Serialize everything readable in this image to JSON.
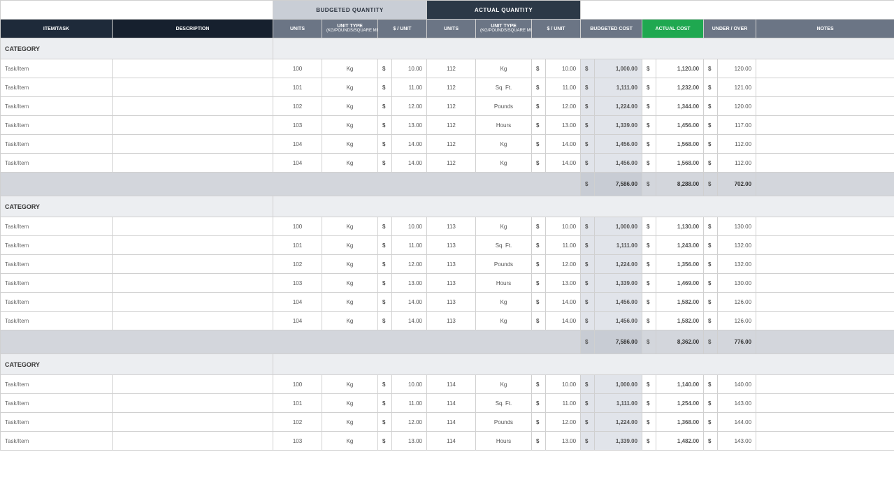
{
  "headers": {
    "group_budget": "BUDGETED QUANTITY",
    "group_actual": "ACTUAL QUANTITY",
    "item_task": "ITEM/TASK",
    "description": "DESCRIPTION",
    "units": "UNITS",
    "unit_type": "UNIT TYPE",
    "unit_type_sub": "(KG/POUNDS/SQUARE METERS)",
    "per_unit": "$ / UNIT",
    "budgeted_cost": "BUDGETED COST",
    "actual_cost": "ACTUAL COST",
    "under_over": "UNDER / OVER",
    "notes": "NOTES"
  },
  "category_label": "CATEGORY",
  "dollar": "$",
  "sections": [
    {
      "rows": [
        {
          "item": "Task/Item",
          "desc": "",
          "b_units": "100",
          "b_type": "Kg",
          "b_unit": "10.00",
          "a_units": "112",
          "a_type": "Kg",
          "a_unit": "10.00",
          "bcost": "1,000.00",
          "acost": "1,120.00",
          "over": "120.00"
        },
        {
          "item": "Task/Item",
          "desc": "",
          "b_units": "101",
          "b_type": "Kg",
          "b_unit": "11.00",
          "a_units": "112",
          "a_type": "Sq. Ft.",
          "a_unit": "11.00",
          "bcost": "1,111.00",
          "acost": "1,232.00",
          "over": "121.00"
        },
        {
          "item": "Task/Item",
          "desc": "",
          "b_units": "102",
          "b_type": "Kg",
          "b_unit": "12.00",
          "a_units": "112",
          "a_type": "Pounds",
          "a_unit": "12.00",
          "bcost": "1,224.00",
          "acost": "1,344.00",
          "over": "120.00"
        },
        {
          "item": "Task/Item",
          "desc": "",
          "b_units": "103",
          "b_type": "Kg",
          "b_unit": "13.00",
          "a_units": "112",
          "a_type": "Hours",
          "a_unit": "13.00",
          "bcost": "1,339.00",
          "acost": "1,456.00",
          "over": "117.00"
        },
        {
          "item": "Task/Item",
          "desc": "",
          "b_units": "104",
          "b_type": "Kg",
          "b_unit": "14.00",
          "a_units": "112",
          "a_type": "Kg",
          "a_unit": "14.00",
          "bcost": "1,456.00",
          "acost": "1,568.00",
          "over": "112.00"
        },
        {
          "item": "Task/Item",
          "desc": "",
          "b_units": "104",
          "b_type": "Kg",
          "b_unit": "14.00",
          "a_units": "112",
          "a_type": "Kg",
          "a_unit": "14.00",
          "bcost": "1,456.00",
          "acost": "1,568.00",
          "over": "112.00"
        }
      ],
      "subtotal": {
        "bcost": "7,586.00",
        "acost": "8,288.00",
        "over": "702.00"
      }
    },
    {
      "rows": [
        {
          "item": "Task/Item",
          "desc": "",
          "b_units": "100",
          "b_type": "Kg",
          "b_unit": "10.00",
          "a_units": "113",
          "a_type": "Kg",
          "a_unit": "10.00",
          "bcost": "1,000.00",
          "acost": "1,130.00",
          "over": "130.00"
        },
        {
          "item": "Task/Item",
          "desc": "",
          "b_units": "101",
          "b_type": "Kg",
          "b_unit": "11.00",
          "a_units": "113",
          "a_type": "Sq. Ft.",
          "a_unit": "11.00",
          "bcost": "1,111.00",
          "acost": "1,243.00",
          "over": "132.00"
        },
        {
          "item": "Task/Item",
          "desc": "",
          "b_units": "102",
          "b_type": "Kg",
          "b_unit": "12.00",
          "a_units": "113",
          "a_type": "Pounds",
          "a_unit": "12.00",
          "bcost": "1,224.00",
          "acost": "1,356.00",
          "over": "132.00"
        },
        {
          "item": "Task/Item",
          "desc": "",
          "b_units": "103",
          "b_type": "Kg",
          "b_unit": "13.00",
          "a_units": "113",
          "a_type": "Hours",
          "a_unit": "13.00",
          "bcost": "1,339.00",
          "acost": "1,469.00",
          "over": "130.00"
        },
        {
          "item": "Task/Item",
          "desc": "",
          "b_units": "104",
          "b_type": "Kg",
          "b_unit": "14.00",
          "a_units": "113",
          "a_type": "Kg",
          "a_unit": "14.00",
          "bcost": "1,456.00",
          "acost": "1,582.00",
          "over": "126.00"
        },
        {
          "item": "Task/Item",
          "desc": "",
          "b_units": "104",
          "b_type": "Kg",
          "b_unit": "14.00",
          "a_units": "113",
          "a_type": "Kg",
          "a_unit": "14.00",
          "bcost": "1,456.00",
          "acost": "1,582.00",
          "over": "126.00"
        }
      ],
      "subtotal": {
        "bcost": "7,586.00",
        "acost": "8,362.00",
        "over": "776.00"
      }
    },
    {
      "rows": [
        {
          "item": "Task/Item",
          "desc": "",
          "b_units": "100",
          "b_type": "Kg",
          "b_unit": "10.00",
          "a_units": "114",
          "a_type": "Kg",
          "a_unit": "10.00",
          "bcost": "1,000.00",
          "acost": "1,140.00",
          "over": "140.00"
        },
        {
          "item": "Task/Item",
          "desc": "",
          "b_units": "101",
          "b_type": "Kg",
          "b_unit": "11.00",
          "a_units": "114",
          "a_type": "Sq. Ft.",
          "a_unit": "11.00",
          "bcost": "1,111.00",
          "acost": "1,254.00",
          "over": "143.00"
        },
        {
          "item": "Task/Item",
          "desc": "",
          "b_units": "102",
          "b_type": "Kg",
          "b_unit": "12.00",
          "a_units": "114",
          "a_type": "Pounds",
          "a_unit": "12.00",
          "bcost": "1,224.00",
          "acost": "1,368.00",
          "over": "144.00"
        },
        {
          "item": "Task/Item",
          "desc": "",
          "b_units": "103",
          "b_type": "Kg",
          "b_unit": "13.00",
          "a_units": "114",
          "a_type": "Hours",
          "a_unit": "13.00",
          "bcost": "1,339.00",
          "acost": "1,482.00",
          "over": "143.00"
        }
      ],
      "subtotal": null
    }
  ]
}
